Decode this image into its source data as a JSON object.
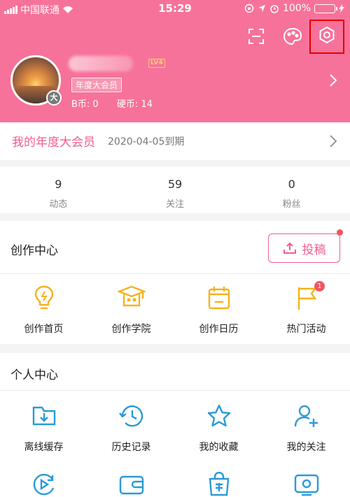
{
  "status_bar": {
    "carrier": "中国联通",
    "time": "15:29",
    "battery": "100%"
  },
  "header": {
    "level": "LV4",
    "vip_tag": "年度大会员",
    "avatar_badge": "大",
    "b_coin": "B币: 0",
    "hard_coin": "硬币: 14",
    "icons": [
      "scan-icon",
      "palette-icon",
      "settings-icon"
    ]
  },
  "vip_row": {
    "title": "我的年度大会员",
    "expiry": "2020-04-05到期"
  },
  "stats": [
    {
      "value": "9",
      "label": "动态"
    },
    {
      "value": "59",
      "label": "关注"
    },
    {
      "value": "0",
      "label": "粉丝"
    }
  ],
  "creation": {
    "title": "创作中心",
    "upload_label": "投稿",
    "items": [
      {
        "label": "创作首页",
        "icon": "lightbulb-icon"
      },
      {
        "label": "创作学院",
        "icon": "graduation-cap-icon"
      },
      {
        "label": "创作日历",
        "icon": "calendar-icon"
      },
      {
        "label": "热门活动",
        "icon": "flag-icon",
        "badge": "1"
      }
    ]
  },
  "personal": {
    "title": "个人中心",
    "items": [
      {
        "label": "离线缓存",
        "icon": "download-folder-icon"
      },
      {
        "label": "历史记录",
        "icon": "history-clock-icon"
      },
      {
        "label": "我的收藏",
        "icon": "star-icon"
      },
      {
        "label": "我的关注",
        "icon": "follow-user-icon"
      }
    ],
    "row2_icons": [
      "play-replay-icon",
      "wallet-icon",
      "shopping-bag-icon",
      "tv-icon"
    ]
  },
  "colors": {
    "brand_pink": "#f7729a",
    "accent_pink": "#f25d8e",
    "creation_icon": "#f5b21b",
    "personal_icon": "#2a9ad8",
    "badge_red": "#f2555f"
  }
}
